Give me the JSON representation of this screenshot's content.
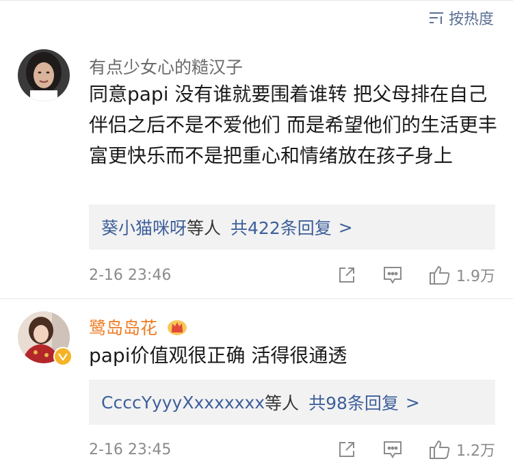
{
  "sort": {
    "label": "按热度"
  },
  "comments": [
    {
      "username": "有点少女心的糙汉子",
      "text": "同意papi 没有谁就要围着谁转 把父母排在自己 伴侣之后不是不爱他们 而是希望他们的生活更丰富更快乐而不是把重心和情绪放在孩子身上",
      "replies": {
        "users": "葵小猫咪呀",
        "suffix": "等人",
        "count": "共422条回复",
        "arrow": ">"
      },
      "time": "2-16 23:46",
      "likes": "1.9万"
    },
    {
      "username": "鹭岛岛花",
      "text": "papi价值观很正确 活得很通透",
      "replies": {
        "users": "CcccYyyyXxxxxxxx",
        "suffix": "等人",
        "count": "共98条回复",
        "arrow": ">"
      },
      "time": "2-16 23:45",
      "likes": "1.2万"
    }
  ],
  "colors": {
    "link": "#3d5f9b",
    "vip_name": "#ee7b22",
    "meta": "#8b8b8b",
    "verified": "#f6b326"
  },
  "icons": [
    "sort-icon",
    "share-icon",
    "comment-icon",
    "like-icon",
    "crown-icon",
    "verified-icon"
  ]
}
